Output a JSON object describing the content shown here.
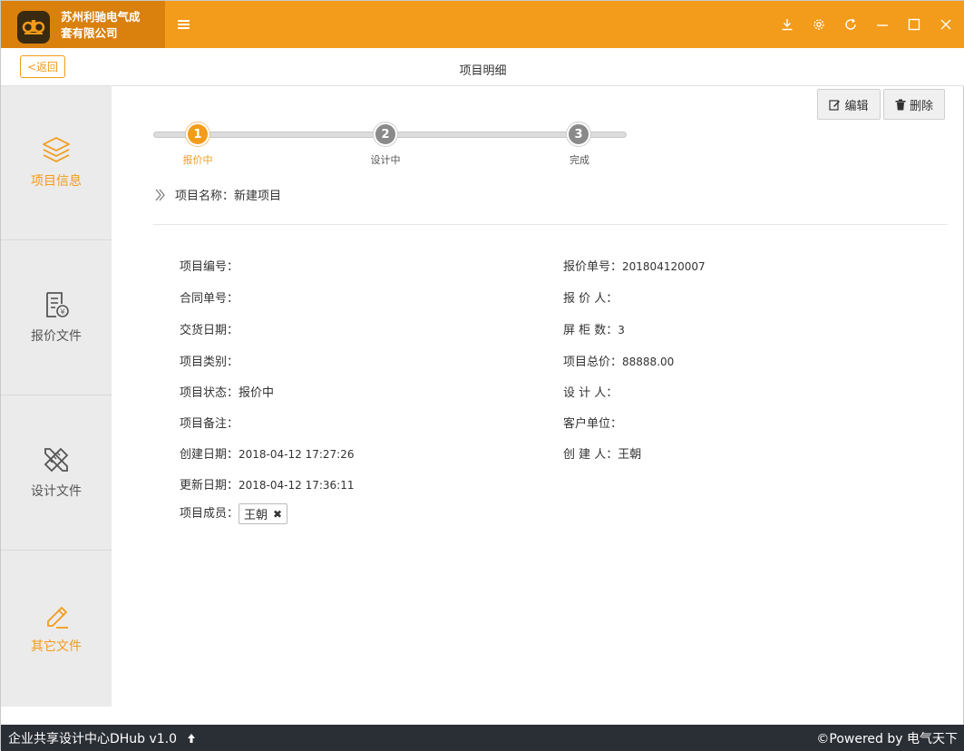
{
  "app": {
    "brand_line1": "苏州利驰电气成",
    "brand_line2": "套有限公司",
    "logo_text": "d-b"
  },
  "colors": {
    "accent": "#f39b1a",
    "brand_dark": "#d9800d",
    "sidebar_bg": "#ebebeb",
    "footer_bg": "#2a2e35"
  },
  "header": {
    "back_label": "<返回",
    "page_title": "项目明细"
  },
  "window_controls": [
    "download-icon",
    "gear-icon",
    "refresh-icon",
    "minimize-icon",
    "maximize-icon",
    "close-icon"
  ],
  "sidebar": {
    "items": [
      {
        "label": "项目信息",
        "icon": "layers-icon",
        "state": "active"
      },
      {
        "label": "报价文件",
        "icon": "quote-doc-icon",
        "state": "normal"
      },
      {
        "label": "设计文件",
        "icon": "pencil-ruler-icon",
        "state": "normal"
      },
      {
        "label": "其它文件",
        "icon": "edit-icon",
        "state": "orange"
      }
    ]
  },
  "actions": {
    "edit_label": "编辑",
    "delete_label": "删除"
  },
  "steps": [
    {
      "num": "1",
      "label": "报价中",
      "state": "active"
    },
    {
      "num": "2",
      "label": "设计中",
      "state": "todo"
    },
    {
      "num": "3",
      "label": "完成",
      "state": "todo"
    }
  ],
  "project": {
    "name_key": "项目名称：",
    "name_value": "新建项目",
    "left_fields": [
      {
        "key": "项目编号：",
        "value": ""
      },
      {
        "key": "合同单号：",
        "value": ""
      },
      {
        "key": "交货日期：",
        "value": ""
      },
      {
        "key": "项目类别：",
        "value": ""
      },
      {
        "key": "项目状态：",
        "value": "报价中"
      },
      {
        "key": "项目备注：",
        "value": ""
      },
      {
        "key": "创建日期：",
        "value": "2018-04-12 17:27:26"
      },
      {
        "key": "更新日期：",
        "value": "2018-04-12 17:36:11"
      }
    ],
    "members_key": "项目成员：",
    "members": [
      "王朝"
    ],
    "right_fields": [
      {
        "key": "报价单号：",
        "value": "201804120007"
      },
      {
        "key": "报 价 人：",
        "value": ""
      },
      {
        "key": "屏 柜 数：",
        "value": "3"
      },
      {
        "key": "项目总价：",
        "value": "88888.00"
      },
      {
        "key": "设 计 人：",
        "value": ""
      },
      {
        "key": "客户单位：",
        "value": ""
      },
      {
        "key": "创 建 人：",
        "value": "王朝"
      }
    ]
  },
  "footer": {
    "left": "企业共享设计中心DHub v1.0",
    "right": "©Powered by 电气天下"
  }
}
